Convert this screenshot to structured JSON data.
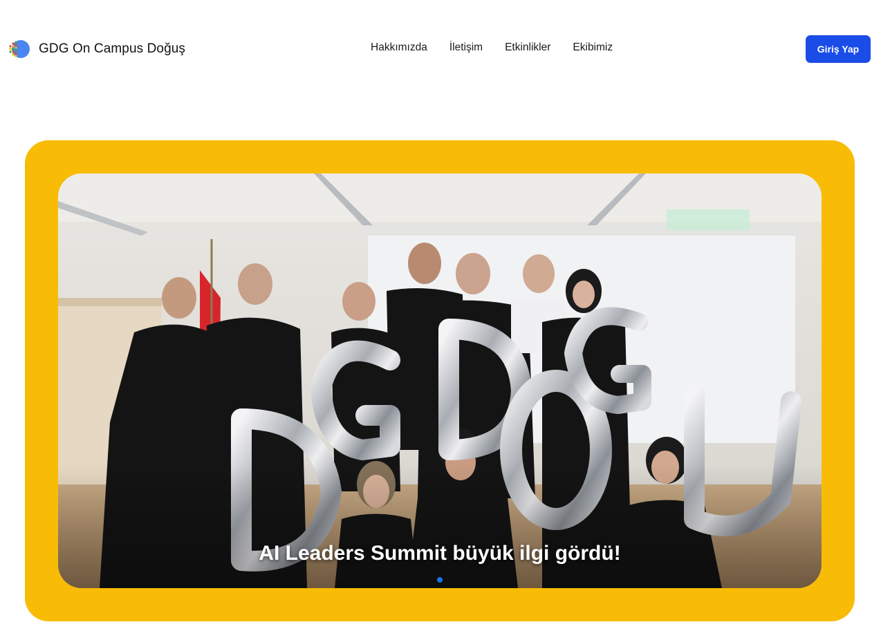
{
  "brand": {
    "name": "GDG On Campus Doğuş",
    "logo_icon": "gdg-logo-icon"
  },
  "nav": {
    "items": [
      {
        "label": "Hakkımızda"
      },
      {
        "label": "İletişim"
      },
      {
        "label": "Etkinlikler"
      },
      {
        "label": "Ekibimiz"
      }
    ]
  },
  "auth": {
    "login_label": "Giriş Yap"
  },
  "hero": {
    "slide_caption": "AI Leaders Summit büyük ilgi gördü!",
    "active_slide": 1,
    "slide_count": 1,
    "frame_color": "#f8bc06",
    "accent_color": "#1a4ce8"
  }
}
